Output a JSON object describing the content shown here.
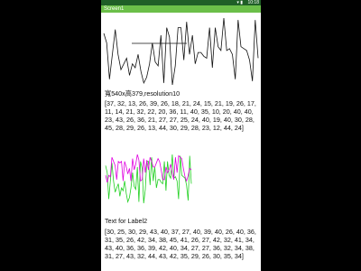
{
  "statusbar": {
    "time": "10:18",
    "icons": "▾ ▮"
  },
  "app": {
    "title": "Screen1"
  },
  "label1": {
    "text": "寬540x高379,resolution10"
  },
  "list1": {
    "text": "[37, 32, 13, 26, 39, 26, 18, 21, 24, 15, 21, 19, 26, 17, 11, 14, 21, 32, 22, 20, 36, 11, 40, 35, 10, 20, 40, 40, 23, 43, 26, 36, 21, 27, 27, 25, 24, 40, 19, 40, 30, 28, 45, 28, 29, 26, 13, 44, 30, 29, 28, 23, 12, 44, 24]"
  },
  "label2": {
    "text": "Text for Label2"
  },
  "list2": {
    "text": "[30, 25, 30, 29, 43, 40, 37, 27, 40, 39, 40, 26, 40, 36, 31, 35, 26, 42, 34, 38, 45, 41, 26, 27, 42, 32, 41, 34, 43, 40, 36, 36, 39, 42, 40, 34, 27, 27, 36, 32, 34, 38, 31, 27, 43, 32, 44, 43, 42, 35, 29, 26, 30, 35, 34]"
  },
  "colors": {
    "statusbar": "#1f5f27",
    "appbar": "#6bbf49",
    "line1": "#111111",
    "line2a": "#e000e0",
    "line2b": "#22d022"
  }
}
